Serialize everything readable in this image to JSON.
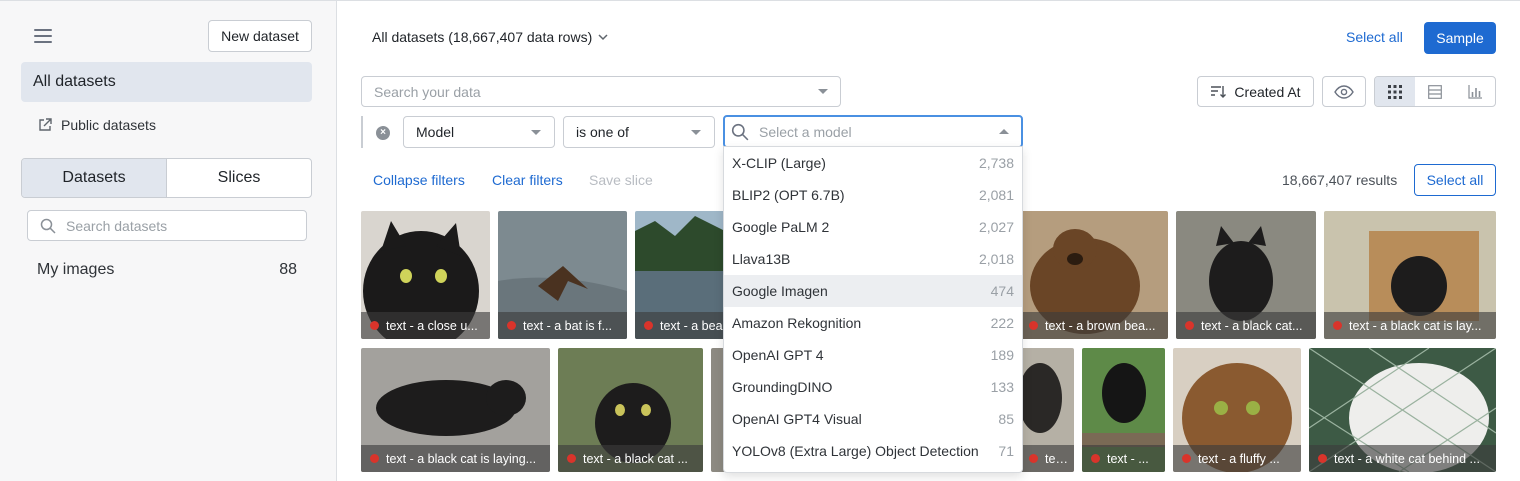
{
  "sidebar": {
    "new_dataset_label": "New dataset",
    "all_datasets_label": "All datasets",
    "public_datasets_label": "Public datasets",
    "tabs": [
      {
        "label": "Datasets",
        "active": true
      },
      {
        "label": "Slices",
        "active": false
      }
    ],
    "search_placeholder": "Search datasets",
    "datasets": [
      {
        "name": "My images",
        "count": "88"
      }
    ]
  },
  "header": {
    "title": "All datasets (18,667,407 data rows)",
    "select_all_label": "Select all",
    "sample_label": "Sample"
  },
  "toolbar": {
    "search_placeholder": "Search your data",
    "sort_label": "Created At"
  },
  "filter": {
    "field": "Model",
    "operator": "is one of",
    "model_placeholder": "Select a model"
  },
  "actions": {
    "collapse_filters": "Collapse filters",
    "clear_filters": "Clear filters",
    "save_slice": "Save slice",
    "results": "18,667,407 results",
    "select_all": "Select all"
  },
  "dropdown_options": [
    {
      "label": "X-CLIP (Large)",
      "count": "2,738"
    },
    {
      "label": "BLIP2 (OPT 6.7B)",
      "count": "2,081"
    },
    {
      "label": "Google PaLM 2",
      "count": "2,027"
    },
    {
      "label": "Llava13B",
      "count": "2,018"
    },
    {
      "label": "Google Imagen",
      "count": "474",
      "highlighted": true
    },
    {
      "label": "Amazon Rekognition",
      "count": "222"
    },
    {
      "label": "OpenAI GPT 4",
      "count": "189"
    },
    {
      "label": "GroundingDINO",
      "count": "133"
    },
    {
      "label": "OpenAI GPT4 Visual",
      "count": "85"
    },
    {
      "label": "YOLOv8 (Extra Large) Object Detection",
      "count": "71"
    }
  ],
  "images": [
    {
      "caption": "text - a close u..."
    },
    {
      "caption": "text - a bat is f..."
    },
    {
      "caption": "text - a bea"
    },
    {
      "caption": "text - a brown bea..."
    },
    {
      "caption": "text - a black cat..."
    },
    {
      "caption": "text - a black cat is lay..."
    },
    {
      "caption": "text - a black cat is laying..."
    },
    {
      "caption": "text - a black cat ..."
    },
    {
      "caption": "text - ..."
    },
    {
      "caption": "text - ..."
    },
    {
      "caption": "text - a fluffy ..."
    },
    {
      "caption": "text - a white cat behind ..."
    }
  ],
  "colors": {
    "accent": "#1e6ad1",
    "selected_bg": "#e1e6ee",
    "label_dot": "#d9342b",
    "focus_border": "#4a90e2"
  }
}
